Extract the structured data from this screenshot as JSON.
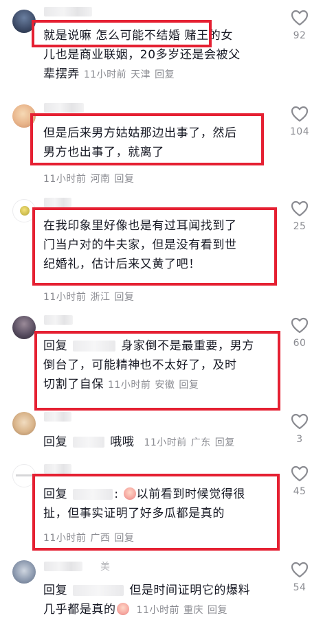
{
  "comments": [
    {
      "body_lines": [
        "就是说嘛  怎么可能不结婚  赌王的女",
        "儿也是商业联姻，20多岁还是会被父",
        "辈摆弄"
      ],
      "time": "11小时前",
      "location": "天津",
      "reply": "回复",
      "likes": "92"
    },
    {
      "body_lines": [
        "但是后来男方姑姑那边出事了，然后",
        "男方也出事了，就离了"
      ],
      "time": "11小时前",
      "location": "河南",
      "reply": "回复",
      "likes": "104"
    },
    {
      "body_lines": [
        "在我印象里好像也是有过耳闻找到了",
        "门当户对的牛夫家，但是没有看到世",
        "纪婚礼，估计后来又黄了吧！"
      ],
      "time": "11小时前",
      "location": "浙江",
      "reply": "回复",
      "likes": "25"
    },
    {
      "prefix": "回复",
      "body_lines": [
        "身家倒不是最重要，男方",
        "倒台了，可能精神也不太好了，及时",
        "切割了自保"
      ],
      "time": "11小时前",
      "location": "安徽",
      "reply": "回复",
      "likes": "60"
    },
    {
      "prefix": "回复",
      "body_tail": "哦哦",
      "time": "11小时前",
      "location": "广东",
      "reply": "回复",
      "likes": "3"
    },
    {
      "prefix": "回复",
      "body_lines": [
        "以前看到时候觉得很",
        "扯，但事实证明了好多瓜都是真的"
      ],
      "time": "11小时前",
      "location": "广西",
      "reply": "回复",
      "likes": "45"
    },
    {
      "username_visible": "美",
      "prefix": "回复",
      "body_lines": [
        "但是时间证明它的爆料",
        "几乎都是真的"
      ],
      "time": "11小时前",
      "location": "重庆",
      "reply": "回复",
      "likes": "54"
    }
  ],
  "icons": {
    "like": "heart-outline-icon",
    "emoji": "crying-face-emoji"
  },
  "colors": {
    "highlight_border": "#e52032",
    "meta_text": "#8a8b91",
    "body_text": "#161823"
  }
}
